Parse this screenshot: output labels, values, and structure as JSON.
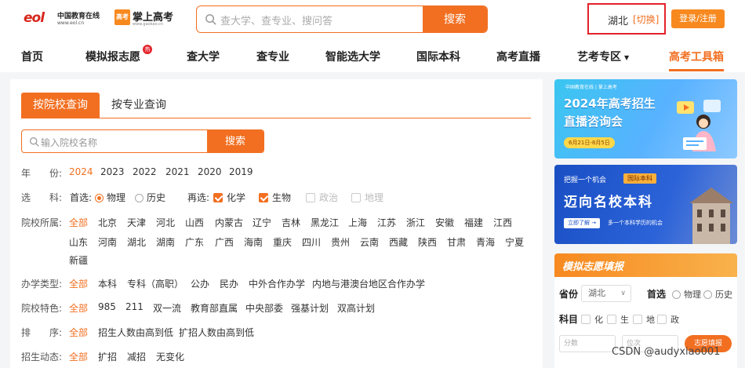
{
  "header": {
    "logo_eol_mark": "eol",
    "logo_eol_cn": "中国教育在线",
    "logo_eol_en": "www.eol.cn",
    "logo_gk_badge": "高考",
    "logo_gk_title": "掌上高考",
    "logo_gk_en": "www.gaokao.cn",
    "search_placeholder": "查大学、查专业、搜问答",
    "search_button": "搜索",
    "province": "湖北",
    "switch_label": "[切换]",
    "login_label": "登录/注册"
  },
  "nav": {
    "items": [
      "首页",
      "模拟报志愿",
      "查大学",
      "查专业",
      "智能选大学",
      "国际本科",
      "高考直播",
      "艺考专区",
      "高考工具箱"
    ],
    "hot_badge": "热",
    "caret": "▼",
    "active_index": 8
  },
  "query": {
    "tabs": [
      "按院校查询",
      "按专业查询"
    ],
    "search_placeholder": "输入院校名称",
    "search_button": "搜索",
    "year_label": "年　　份:",
    "years": [
      "2024",
      "2023",
      "2022",
      "2021",
      "2020",
      "2019"
    ],
    "subject_label": "选　　科:",
    "first_choice_label": "首选:",
    "first_options": [
      "物理",
      "历史"
    ],
    "second_choice_label": "再选:",
    "second_options": [
      "化学",
      "生物",
      "政治",
      "地理"
    ],
    "location_label": "院校所属:",
    "locations_row1": [
      "全部",
      "北京",
      "天津",
      "河北",
      "山西",
      "内蒙古",
      "辽宁",
      "吉林",
      "黑龙江",
      "上海",
      "江苏",
      "浙江",
      "安徽",
      "福建",
      "江西"
    ],
    "locations_row2": [
      "山东",
      "河南",
      "湖北",
      "湖南",
      "广东",
      "广西",
      "海南",
      "重庆",
      "四川",
      "贵州",
      "云南",
      "西藏",
      "陕西",
      "甘肃",
      "青海",
      "宁夏"
    ],
    "locations_row3": [
      "新疆"
    ],
    "type_label": "办学类型:",
    "types": [
      "全部",
      "本科",
      "专科（高职）",
      "公办",
      "民办",
      "中外合作办学",
      "内地与港澳台地区合作办学"
    ],
    "feature_label": "院校特色:",
    "features": [
      "全部",
      "985",
      "211",
      "双一流",
      "教育部直属",
      "中央部委",
      "强基计划",
      "双高计划"
    ],
    "sort_label": "排　　序:",
    "sorts": [
      "全部",
      "招生人数由高到低",
      "扩招人数由高到低"
    ],
    "trend_label": "招生动态:",
    "trends": [
      "全部",
      "扩招",
      "减招",
      "无变化"
    ]
  },
  "banner1": {
    "logo_text": "中国教育在线 | 掌上高考",
    "title_line1": "2024年高考招生",
    "title_line2": "直播咨询会",
    "date": "6月21日-8月5日"
  },
  "banner2": {
    "subtitle": "把握一个机会",
    "tag": "国际本科",
    "title": "迈向名校本科",
    "button": "立即了解 →",
    "note": "多一个本科学历的机会"
  },
  "sim": {
    "title": "模拟志愿填报",
    "province_label": "省份",
    "province_value": "湖北",
    "first_label": "首选",
    "first_options": [
      "物理",
      "历史"
    ],
    "subject_label": "科目",
    "subjects": [
      "化",
      "生",
      "地",
      "政"
    ],
    "score_placeholder": "分数",
    "rank_placeholder": "位次",
    "submit": "志愿填报"
  },
  "watermark": "CSDN @audyxiao001",
  "colors": {
    "accent": "#f26f21",
    "highlight_box": "#e3222a",
    "page_bg": "#f4f5f7"
  }
}
